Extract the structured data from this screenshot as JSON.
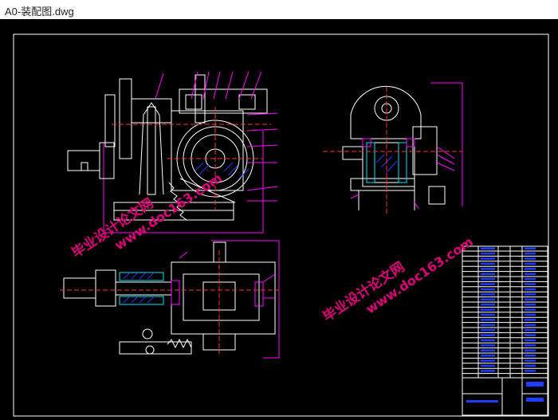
{
  "window": {
    "title": "A0-装配图.dwg"
  },
  "watermark": {
    "line1": "毕业设计论文网",
    "line2": "www.doc163.com"
  },
  "colors": {
    "background": "#000000",
    "frame": "#ffffff",
    "part_white": "#ffffff",
    "dimension_magenta": "#ff00ff",
    "centerline_red": "#ff3030",
    "hatch_cyan": "#00e5ff",
    "hatch_blue": "#1e3cff",
    "watermark": "#e0007a"
  }
}
